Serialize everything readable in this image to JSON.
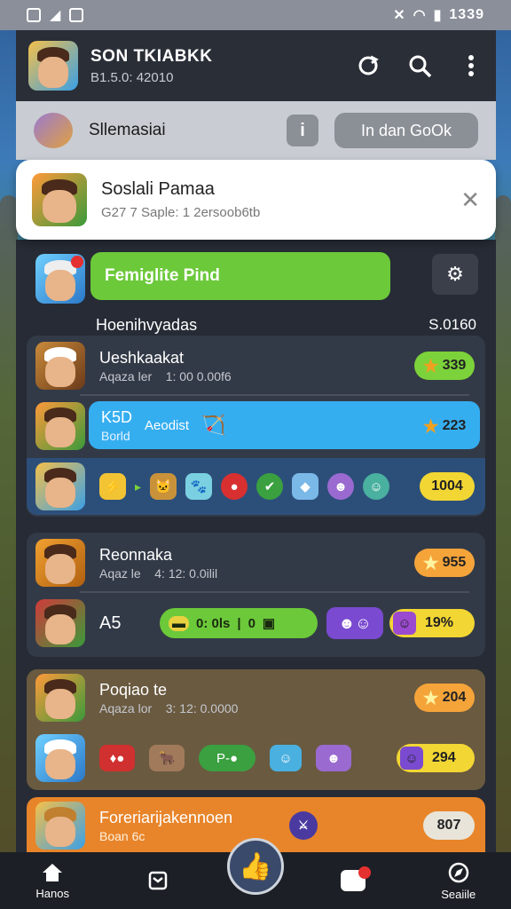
{
  "status": {
    "time": "1339"
  },
  "header": {
    "title": "SON TKIABKK",
    "subtitle": "B1.5.0: 42010"
  },
  "banner": {
    "label": "Sllemasiai",
    "info_label": "i",
    "button_label": "In dan GoOk"
  },
  "notification": {
    "title": "Soslali Pamaa",
    "subtitle": "G27 7 Saple: 1 2ersoob6tb"
  },
  "hero": {
    "green_label": "Femiglite Pind",
    "section_title": "Hoenihvyadas",
    "right_value": "S.0160"
  },
  "group1": {
    "row1": {
      "title": "Ueshkaakat",
      "sub": "Aqaza ler",
      "meta": "1: 00 0.00f6",
      "score": "339"
    },
    "row2": {
      "title": "K5D",
      "sub": "Borld",
      "tag": "Aeodist",
      "score": "223"
    },
    "row3": {
      "score": "1004"
    }
  },
  "group2": {
    "row1": {
      "title": "Reonnaka",
      "sub": "Aqaz le",
      "meta": "4: 12: 0.0ilil",
      "score": "955"
    },
    "row2": {
      "title": "A5",
      "progress_text": "0: 0ls",
      "progress_value": "0",
      "percent": "19%"
    }
  },
  "group3": {
    "row1": {
      "title": "Poqiao te",
      "sub": "Aqaza lor",
      "meta": "3: 12: 0.0000",
      "score": "204"
    },
    "row2": {
      "score": "294"
    }
  },
  "group4": {
    "row1": {
      "title": "Foreriarijakennoen",
      "sub": "Boan 6c",
      "score": "807"
    }
  },
  "nav": {
    "item1": "Hanos",
    "item5": "Seaiile"
  },
  "colors": {
    "accent_green": "#6cc93a",
    "accent_blue": "#35aef0",
    "accent_orange": "#e8852a",
    "score_yellow": "#f2d633"
  }
}
